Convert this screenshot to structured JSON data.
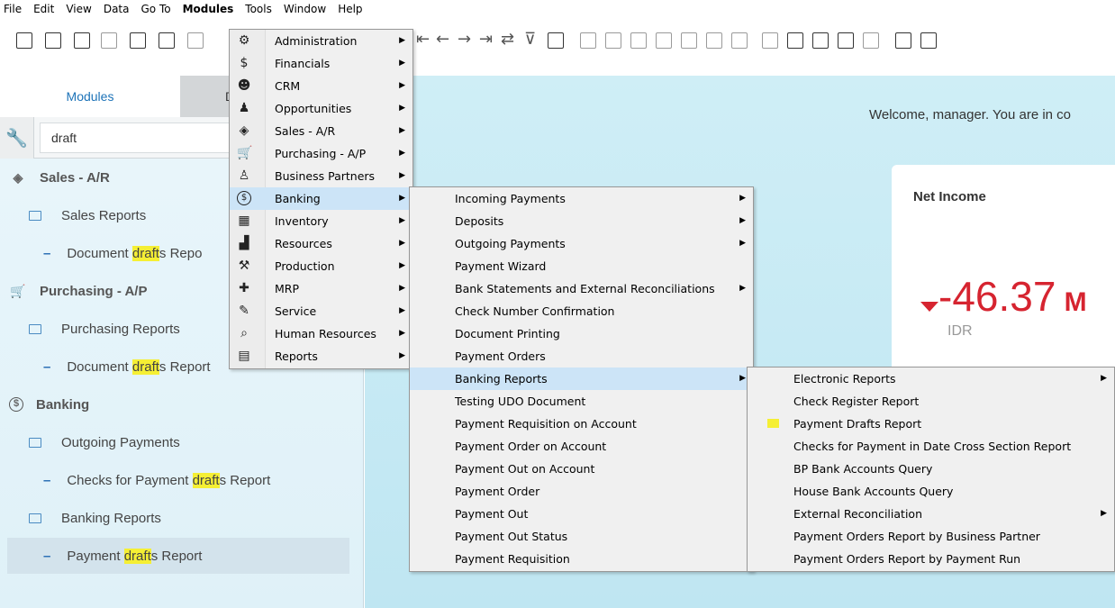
{
  "menubar": [
    "File",
    "Edit",
    "View",
    "Data",
    "Go To",
    "Modules",
    "Tools",
    "Window",
    "Help"
  ],
  "left_panel": {
    "tab_modules": "Modules",
    "tab_other": "D",
    "search_value": "draft",
    "tree": [
      {
        "level": 0,
        "icon": "sales-icon",
        "pre": "Sales - A/R",
        "hl": "",
        "post": ""
      },
      {
        "level": 1,
        "pre": "Sales Reports",
        "hl": "",
        "post": ""
      },
      {
        "level": 2,
        "pre": "Document ",
        "hl": "draft",
        "post": "s Repo"
      },
      {
        "level": 0,
        "icon": "cart-icon",
        "pre": "Purchasing - A/P",
        "hl": "",
        "post": ""
      },
      {
        "level": 1,
        "pre": "Purchasing Reports",
        "hl": "",
        "post": ""
      },
      {
        "level": 2,
        "pre": "Document ",
        "hl": "draft",
        "post": "s Report"
      },
      {
        "level": 0,
        "icon": "dollar-circle-icon",
        "pre": "Banking",
        "hl": "",
        "post": ""
      },
      {
        "level": 1,
        "pre": "Outgoing Payments",
        "hl": "",
        "post": ""
      },
      {
        "level": 2,
        "pre": "Checks for Payment ",
        "hl": "draft",
        "post": "s Report"
      },
      {
        "level": 1,
        "pre": "Banking Reports",
        "hl": "",
        "post": ""
      },
      {
        "level": 2,
        "pre": "Payment ",
        "hl": "draft",
        "post": "s Report",
        "selected": true
      }
    ]
  },
  "dashboard": {
    "welcome": "Welcome, manager. You are in co",
    "card_title": "Net Income",
    "kpi_value": "-46.37",
    "kpi_suffix": "M",
    "kpi_unit": "IDR"
  },
  "modules_menu": [
    {
      "label": "Administration",
      "icon": "admin-icon"
    },
    {
      "label": "Financials",
      "icon": "financials-icon"
    },
    {
      "label": "CRM",
      "icon": "crm-icon"
    },
    {
      "label": "Opportunities",
      "icon": "opportunities-icon"
    },
    {
      "label": "Sales - A/R",
      "icon": "sales-icon"
    },
    {
      "label": "Purchasing - A/P",
      "icon": "cart-icon"
    },
    {
      "label": "Business Partners",
      "icon": "person-icon"
    },
    {
      "label": "Banking",
      "icon": "dollar-circle-icon",
      "hot": true
    },
    {
      "label": "Inventory",
      "icon": "inventory-icon"
    },
    {
      "label": "Resources",
      "icon": "factory-icon"
    },
    {
      "label": "Production",
      "icon": "production-icon"
    },
    {
      "label": "MRP",
      "icon": "puzzle-icon"
    },
    {
      "label": "Service",
      "icon": "service-icon"
    },
    {
      "label": "Human Resources",
      "icon": "search-person-icon"
    },
    {
      "label": "Reports",
      "icon": "report-icon"
    }
  ],
  "banking_menu": [
    {
      "label": "Incoming Payments",
      "arrow": true
    },
    {
      "label": "Deposits",
      "arrow": true
    },
    {
      "label": "Outgoing Payments",
      "arrow": true
    },
    {
      "label": "Payment Wizard"
    },
    {
      "label": "Bank Statements and External Reconciliations",
      "arrow": true
    },
    {
      "label": "Check Number Confirmation"
    },
    {
      "label": "Document Printing"
    },
    {
      "label": "Payment Orders"
    },
    {
      "label": "Banking Reports",
      "arrow": true,
      "hot": true
    },
    {
      "label": "Testing UDO Document"
    },
    {
      "label": "Payment Requisition on Account"
    },
    {
      "label": "Payment Order on Account"
    },
    {
      "label": "Payment Out on Account"
    },
    {
      "label": "Payment Order"
    },
    {
      "label": "Payment Out"
    },
    {
      "label": "Payment Out Status"
    },
    {
      "label": "Payment Requisition"
    }
  ],
  "banking_reports_menu": [
    {
      "label": "Electronic Reports",
      "arrow": true
    },
    {
      "label": "Check Register Report"
    },
    {
      "label": "Payment Drafts Report",
      "marked": true
    },
    {
      "label": "Checks for Payment in Date Cross Section Report"
    },
    {
      "label": "BP Bank Accounts Query"
    },
    {
      "label": "House Bank Accounts Query"
    },
    {
      "label": "External Reconciliation",
      "arrow": true
    },
    {
      "label": "Payment Orders Report by Business Partner"
    },
    {
      "label": "Payment Orders Report by Payment Run"
    }
  ],
  "colors": {
    "accent": "#1d73b8",
    "highlight": "#f5ef34",
    "negative": "#d62430",
    "menu_hot": "#cce4f7"
  }
}
